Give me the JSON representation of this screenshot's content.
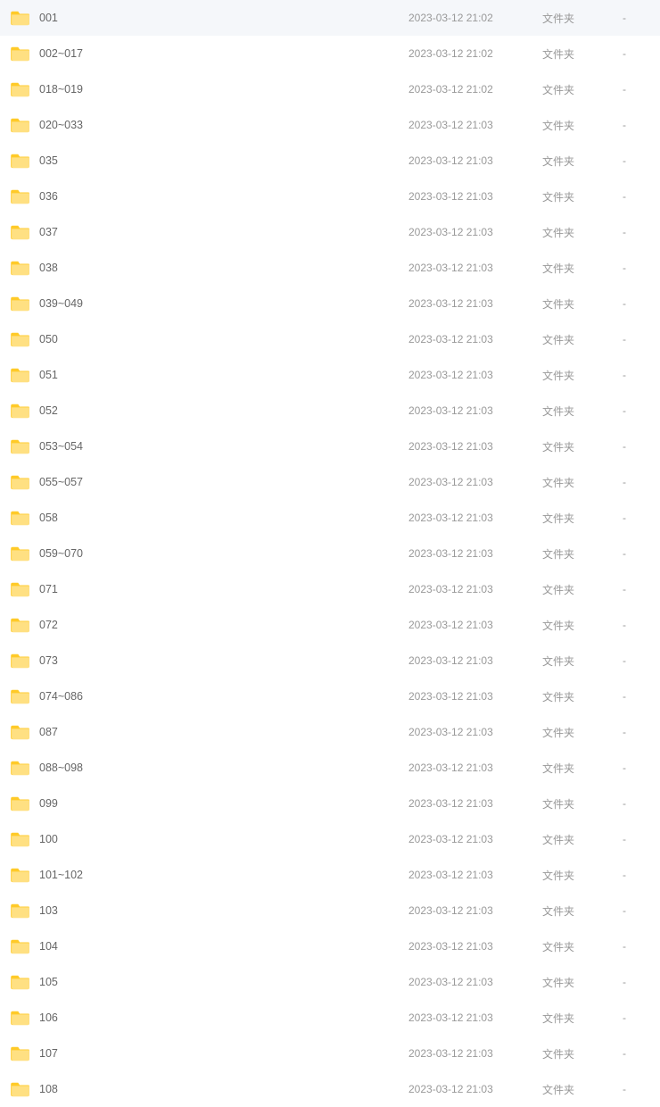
{
  "files": [
    {
      "name": "001",
      "date": "2023-03-12 21:02",
      "type": "文件夹",
      "size": "-"
    },
    {
      "name": "002~017",
      "date": "2023-03-12 21:02",
      "type": "文件夹",
      "size": "-"
    },
    {
      "name": "018~019",
      "date": "2023-03-12 21:02",
      "type": "文件夹",
      "size": "-"
    },
    {
      "name": "020~033",
      "date": "2023-03-12 21:03",
      "type": "文件夹",
      "size": "-"
    },
    {
      "name": "035",
      "date": "2023-03-12 21:03",
      "type": "文件夹",
      "size": "-"
    },
    {
      "name": "036",
      "date": "2023-03-12 21:03",
      "type": "文件夹",
      "size": "-"
    },
    {
      "name": "037",
      "date": "2023-03-12 21:03",
      "type": "文件夹",
      "size": "-"
    },
    {
      "name": "038",
      "date": "2023-03-12 21:03",
      "type": "文件夹",
      "size": "-"
    },
    {
      "name": "039~049",
      "date": "2023-03-12 21:03",
      "type": "文件夹",
      "size": "-"
    },
    {
      "name": "050",
      "date": "2023-03-12 21:03",
      "type": "文件夹",
      "size": "-"
    },
    {
      "name": "051",
      "date": "2023-03-12 21:03",
      "type": "文件夹",
      "size": "-"
    },
    {
      "name": "052",
      "date": "2023-03-12 21:03",
      "type": "文件夹",
      "size": "-"
    },
    {
      "name": "053~054",
      "date": "2023-03-12 21:03",
      "type": "文件夹",
      "size": "-"
    },
    {
      "name": "055~057",
      "date": "2023-03-12 21:03",
      "type": "文件夹",
      "size": "-"
    },
    {
      "name": "058",
      "date": "2023-03-12 21:03",
      "type": "文件夹",
      "size": "-"
    },
    {
      "name": "059~070",
      "date": "2023-03-12 21:03",
      "type": "文件夹",
      "size": "-"
    },
    {
      "name": "071",
      "date": "2023-03-12 21:03",
      "type": "文件夹",
      "size": "-"
    },
    {
      "name": "072",
      "date": "2023-03-12 21:03",
      "type": "文件夹",
      "size": "-"
    },
    {
      "name": "073",
      "date": "2023-03-12 21:03",
      "type": "文件夹",
      "size": "-"
    },
    {
      "name": "074~086",
      "date": "2023-03-12 21:03",
      "type": "文件夹",
      "size": "-"
    },
    {
      "name": "087",
      "date": "2023-03-12 21:03",
      "type": "文件夹",
      "size": "-"
    },
    {
      "name": "088~098",
      "date": "2023-03-12 21:03",
      "type": "文件夹",
      "size": "-"
    },
    {
      "name": "099",
      "date": "2023-03-12 21:03",
      "type": "文件夹",
      "size": "-"
    },
    {
      "name": "100",
      "date": "2023-03-12 21:03",
      "type": "文件夹",
      "size": "-"
    },
    {
      "name": "101~102",
      "date": "2023-03-12 21:03",
      "type": "文件夹",
      "size": "-"
    },
    {
      "name": "103",
      "date": "2023-03-12 21:03",
      "type": "文件夹",
      "size": "-"
    },
    {
      "name": "104",
      "date": "2023-03-12 21:03",
      "type": "文件夹",
      "size": "-"
    },
    {
      "name": "105",
      "date": "2023-03-12 21:03",
      "type": "文件夹",
      "size": "-"
    },
    {
      "name": "106",
      "date": "2023-03-12 21:03",
      "type": "文件夹",
      "size": "-"
    },
    {
      "name": "107",
      "date": "2023-03-12 21:03",
      "type": "文件夹",
      "size": "-"
    },
    {
      "name": "108",
      "date": "2023-03-12 21:03",
      "type": "文件夹",
      "size": "-"
    }
  ]
}
